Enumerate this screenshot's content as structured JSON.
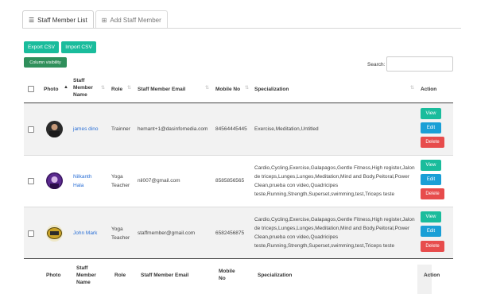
{
  "tabs": [
    {
      "label": "Staff Member List",
      "icon": "list-icon",
      "active": true
    },
    {
      "label": "Add Staff Member",
      "icon": "plus-square-icon",
      "active": false
    }
  ],
  "toolbar": {
    "export_label": "Export CSV",
    "import_label": "Import CSV",
    "column_visibility_label": "Column visibility"
  },
  "search": {
    "label": "Search:",
    "value": ""
  },
  "table": {
    "headers": {
      "photo": "Photo",
      "name_line1": "Staff",
      "name_line2": "Member",
      "name_line3": "Name",
      "role": "Role",
      "email": "Staff Member Email",
      "mobile": "Mobile No",
      "specialization": "Specialization",
      "action": "Action"
    },
    "footer": {
      "photo": "Photo",
      "name_line1": "Staff",
      "name_line2": "Member",
      "name_line3": "Name",
      "role": "Role",
      "email": "Staff Member Email",
      "mobile_line1": "Mobile",
      "mobile_line2": "No",
      "specialization": "Specialization",
      "action": "Action"
    },
    "rows": [
      {
        "name": "james dino",
        "role_line1": "Trainner",
        "role_line2": "",
        "email": "hemant+1@dasinfomedia.com",
        "mobile": "84564445445",
        "spec_lines": [
          "Exercise,Meditation,Untitled"
        ]
      },
      {
        "name_line1": "Nilkanth",
        "name_line2": "Hala",
        "role_line1": "Yoga",
        "role_line2": "Teacher",
        "email": "nil007@gmail.com",
        "mobile": "8585856565",
        "spec_lines": [
          "Cardio,Cycling,Exercise,Galapagos,Gentle Fitness,High register,Jalon",
          "de triceps,Lunges,Lunges,Meditation,Mind and Body,Peitoral,Power",
          "Clean,prueba con video,Quadricipes",
          "teste,Running,Strength,Superset,swimming,test,Triceps teste"
        ]
      },
      {
        "name": "John Mark",
        "role_line1": "Yoga",
        "role_line2": "Teacher",
        "email": "staffmember@gmail.com",
        "mobile": "6582456875",
        "spec_lines": [
          "Cardio,Cycling,Exercise,Galapagos,Gentle Fitness,High register,Jalon",
          "de triceps,Lunges,Lunges,Meditation,Mind and Body,Peitoral,Power",
          "Clean,prueba con video,Quadricipes",
          "teste,Running,Strength,Superset,swimming,test,Triceps teste"
        ]
      }
    ],
    "actions": {
      "view": "View",
      "edit": "Edit",
      "delete": "Delete"
    }
  }
}
